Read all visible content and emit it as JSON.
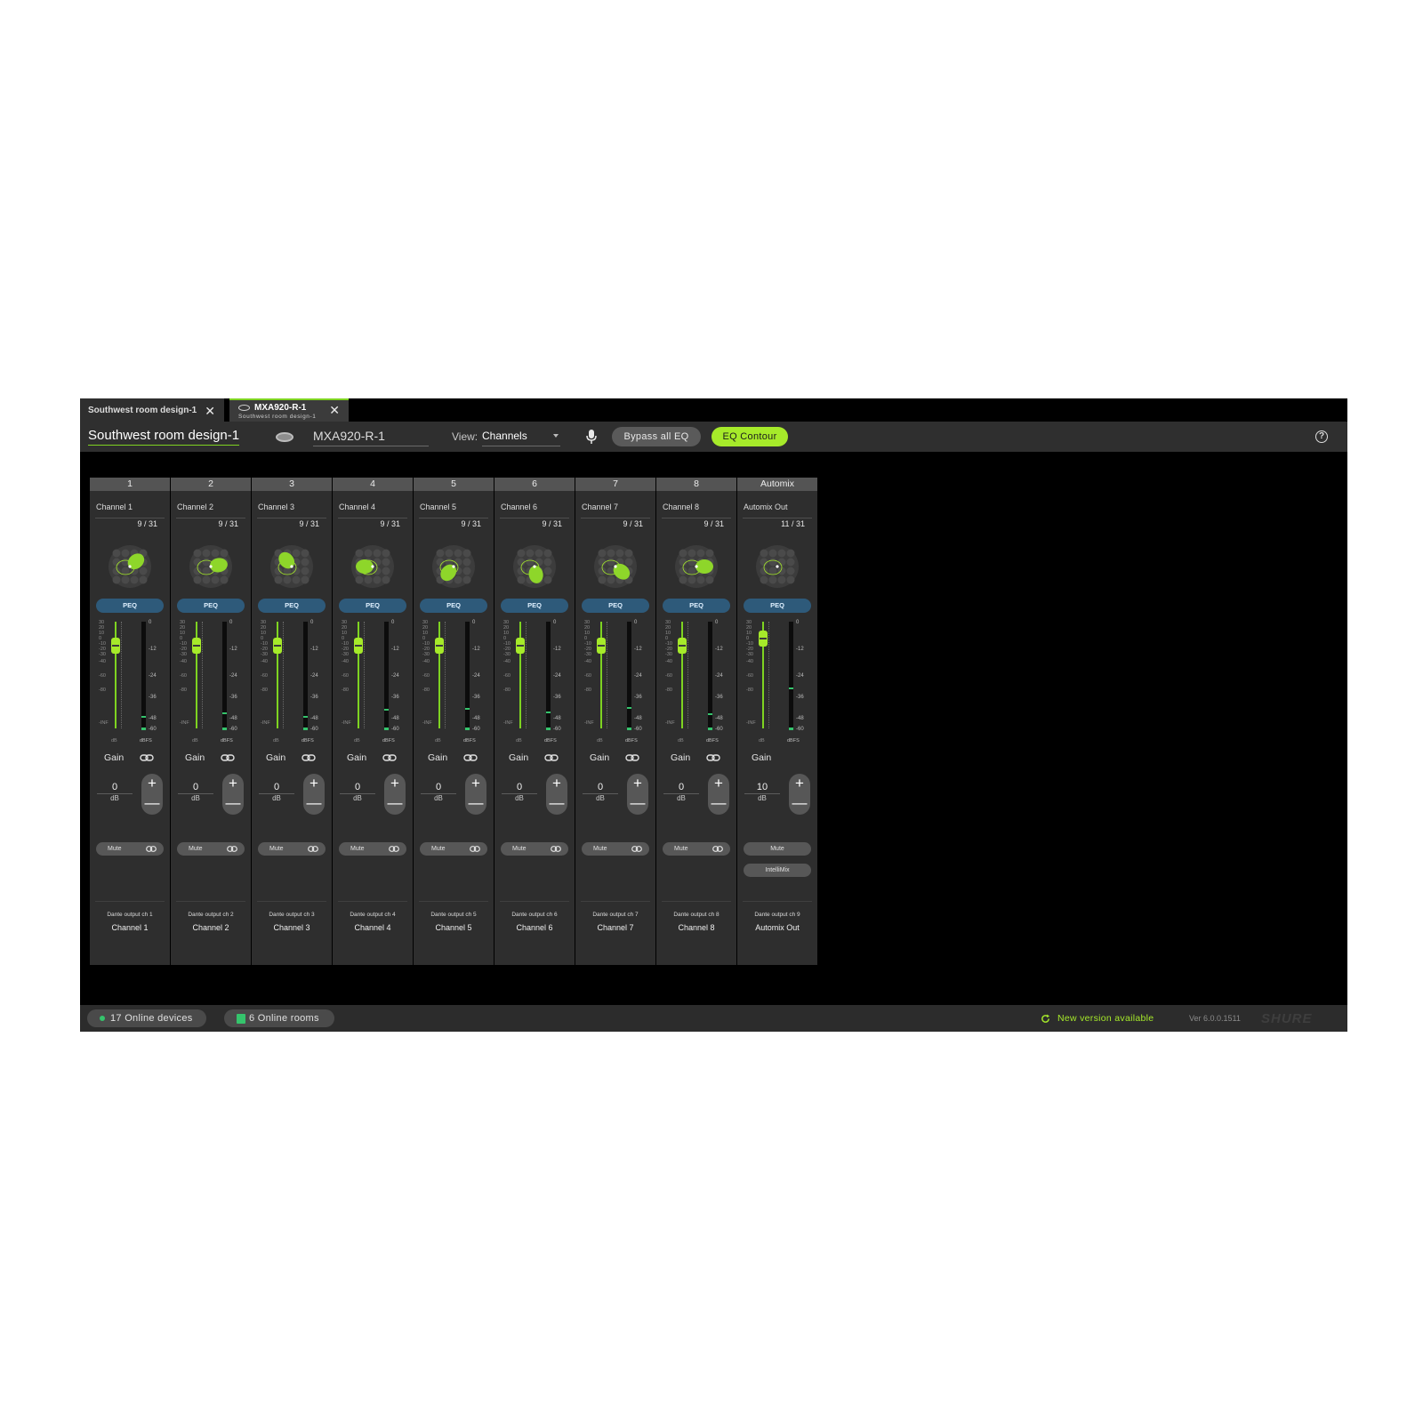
{
  "tabs": [
    {
      "label": "Southwest room design-1",
      "close": "✕"
    },
    {
      "label": "MXA920-R-1",
      "sublabel": "Southwest room design-1",
      "close": "✕"
    }
  ],
  "toolbar": {
    "design_title": "Southwest room design-1",
    "device_name": "MXA920-R-1",
    "view_label": "View:",
    "view_value": "Channels",
    "bypass_label": "Bypass all EQ",
    "eq_contour_label": "EQ Contour",
    "help_icon": "?"
  },
  "mixer": {
    "scale_left": [
      "30",
      "20",
      "10",
      "0",
      "-10",
      "-20",
      "-30",
      "-40",
      "-60",
      "-80",
      "-INF"
    ],
    "scale_right": [
      "0",
      "-12",
      "-24",
      "-36",
      "-48",
      "-60"
    ],
    "unit_left": "dB",
    "unit_right": "dBFS",
    "gain_label": "Gain",
    "gain_unit": "dB",
    "plus": "+",
    "minus": "—",
    "peq_label": "PEQ",
    "mute_label": "Mute",
    "intellimix_label": "IntelliMix",
    "channels": [
      {
        "header": "1",
        "name": "Channel 1",
        "count": "9 / 31",
        "gain": "0",
        "dante": "Dante output ch 1",
        "output": "Channel 1",
        "lobe_angle": -40,
        "meter_peak": 0.12
      },
      {
        "header": "2",
        "name": "Channel 2",
        "count": "9 / 31",
        "gain": "0",
        "dante": "Dante output ch 2",
        "output": "Channel 2",
        "lobe_angle": -10,
        "meter_peak": 0.15
      },
      {
        "header": "3",
        "name": "Channel 3",
        "count": "9 / 31",
        "gain": "0",
        "dante": "Dante output ch 3",
        "output": "Channel 3",
        "lobe_angle": -130,
        "meter_peak": 0.12
      },
      {
        "header": "4",
        "name": "Channel 4",
        "count": "9 / 31",
        "gain": "0",
        "dante": "Dante output ch 4",
        "output": "Channel 4",
        "lobe_angle": 180,
        "meter_peak": 0.18
      },
      {
        "header": "5",
        "name": "Channel 5",
        "count": "9 / 31",
        "gain": "0",
        "dante": "Dante output ch 5",
        "output": "Channel 5",
        "lobe_angle": 130,
        "meter_peak": 0.19
      },
      {
        "header": "6",
        "name": "Channel 6",
        "count": "9 / 31",
        "gain": "0",
        "dante": "Dante output ch 6",
        "output": "Channel 6",
        "lobe_angle": 80,
        "meter_peak": 0.16
      },
      {
        "header": "7",
        "name": "Channel 7",
        "count": "9 / 31",
        "gain": "0",
        "dante": "Dante output ch 7",
        "output": "Channel 7",
        "lobe_angle": 40,
        "meter_peak": 0.2
      },
      {
        "header": "8",
        "name": "Channel 8",
        "count": "9 / 31",
        "gain": "0",
        "dante": "Dante output ch 8",
        "output": "Channel 8",
        "lobe_angle": 0,
        "meter_peak": 0.14
      }
    ],
    "automix": {
      "header": "Automix",
      "name": "Automix Out",
      "count": "11 / 31",
      "gain": "10",
      "dante": "Dante output ch 9",
      "output": "Automix Out",
      "meter_peak": 0.38
    }
  },
  "status": {
    "devices": "17 Online devices",
    "rooms": "6 Online rooms",
    "update": "New version available",
    "version": "Ver 6.0.0.1511",
    "brand": "SHURE"
  },
  "colors": {
    "accent": "#a6ea2a",
    "meter": "#35c46c",
    "peq": "#2e5a7a"
  }
}
